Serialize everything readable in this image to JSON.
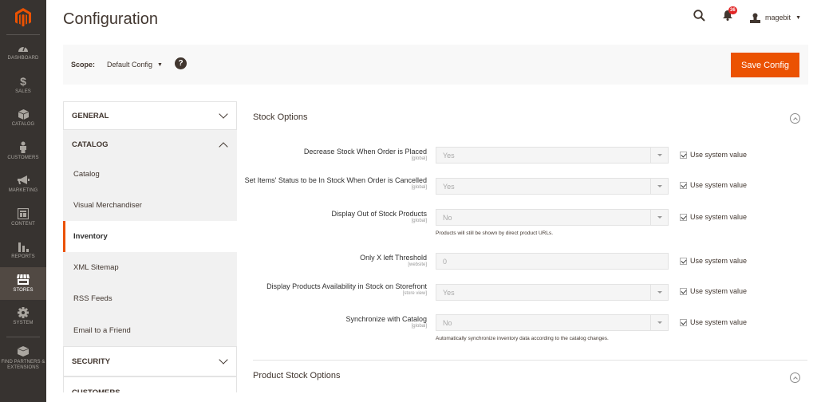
{
  "menu": {
    "items": [
      {
        "label": "Dashboard",
        "icon": "dashboard-icon",
        "active": false
      },
      {
        "label": "Sales",
        "icon": "dollar-icon",
        "active": false
      },
      {
        "label": "Catalog",
        "icon": "box-icon",
        "active": false
      },
      {
        "label": "Customers",
        "icon": "person-icon",
        "active": false
      },
      {
        "label": "Marketing",
        "icon": "megaphone-icon",
        "active": false
      },
      {
        "label": "Content",
        "icon": "layout-icon",
        "active": false
      },
      {
        "label": "Reports",
        "icon": "bar-chart-icon",
        "active": false
      },
      {
        "label": "Stores",
        "icon": "store-icon",
        "active": true
      },
      {
        "label": "System",
        "icon": "gear-icon",
        "active": false
      }
    ],
    "partners_label": "Find Partners & Extensions"
  },
  "header": {
    "title": "Configuration",
    "notifications_count": "36",
    "user_name": "magebit"
  },
  "scope": {
    "label": "Scope:",
    "value": "Default Config",
    "help": "?"
  },
  "actions": {
    "save_label": "Save Config"
  },
  "tabs": {
    "general": "GENERAL",
    "catalog": "CATALOG",
    "catalog_items": [
      "Catalog",
      "Visual Merchandiser",
      "Inventory",
      "XML Sitemap",
      "RSS Feeds",
      "Email to a Friend"
    ],
    "active_item": "Inventory",
    "security": "SECURITY",
    "customers": "CUSTOMERS"
  },
  "sections": {
    "stock_options": {
      "title": "Stock Options",
      "fields": [
        {
          "label": "Decrease Stock When Order is Placed",
          "scope": "[global]",
          "value": "Yes",
          "type": "select",
          "note": "",
          "use_system_value": true
        },
        {
          "label": "Set Items' Status to be In Stock When Order is Cancelled",
          "scope": "[global]",
          "value": "Yes",
          "type": "select",
          "note": "",
          "use_system_value": true
        },
        {
          "label": "Display Out of Stock Products",
          "scope": "[global]",
          "value": "No",
          "type": "select",
          "note": "Products will still be shown by direct product URLs.",
          "use_system_value": true
        },
        {
          "label": "Only X left Threshold",
          "scope": "[website]",
          "value": "0",
          "type": "text",
          "note": "",
          "use_system_value": true
        },
        {
          "label": "Display Products Availability in Stock on Storefront",
          "scope": "[store view]",
          "value": "Yes",
          "type": "select",
          "note": "",
          "use_system_value": true
        },
        {
          "label": "Synchronize with Catalog",
          "scope": "[global]",
          "value": "No",
          "type": "select",
          "note": "Automatically synchronize inventory data according to the catalog changes.",
          "use_system_value": true
        }
      ],
      "use_system_label": "Use system value"
    },
    "product_stock_options": {
      "title": "Product Stock Options"
    }
  }
}
